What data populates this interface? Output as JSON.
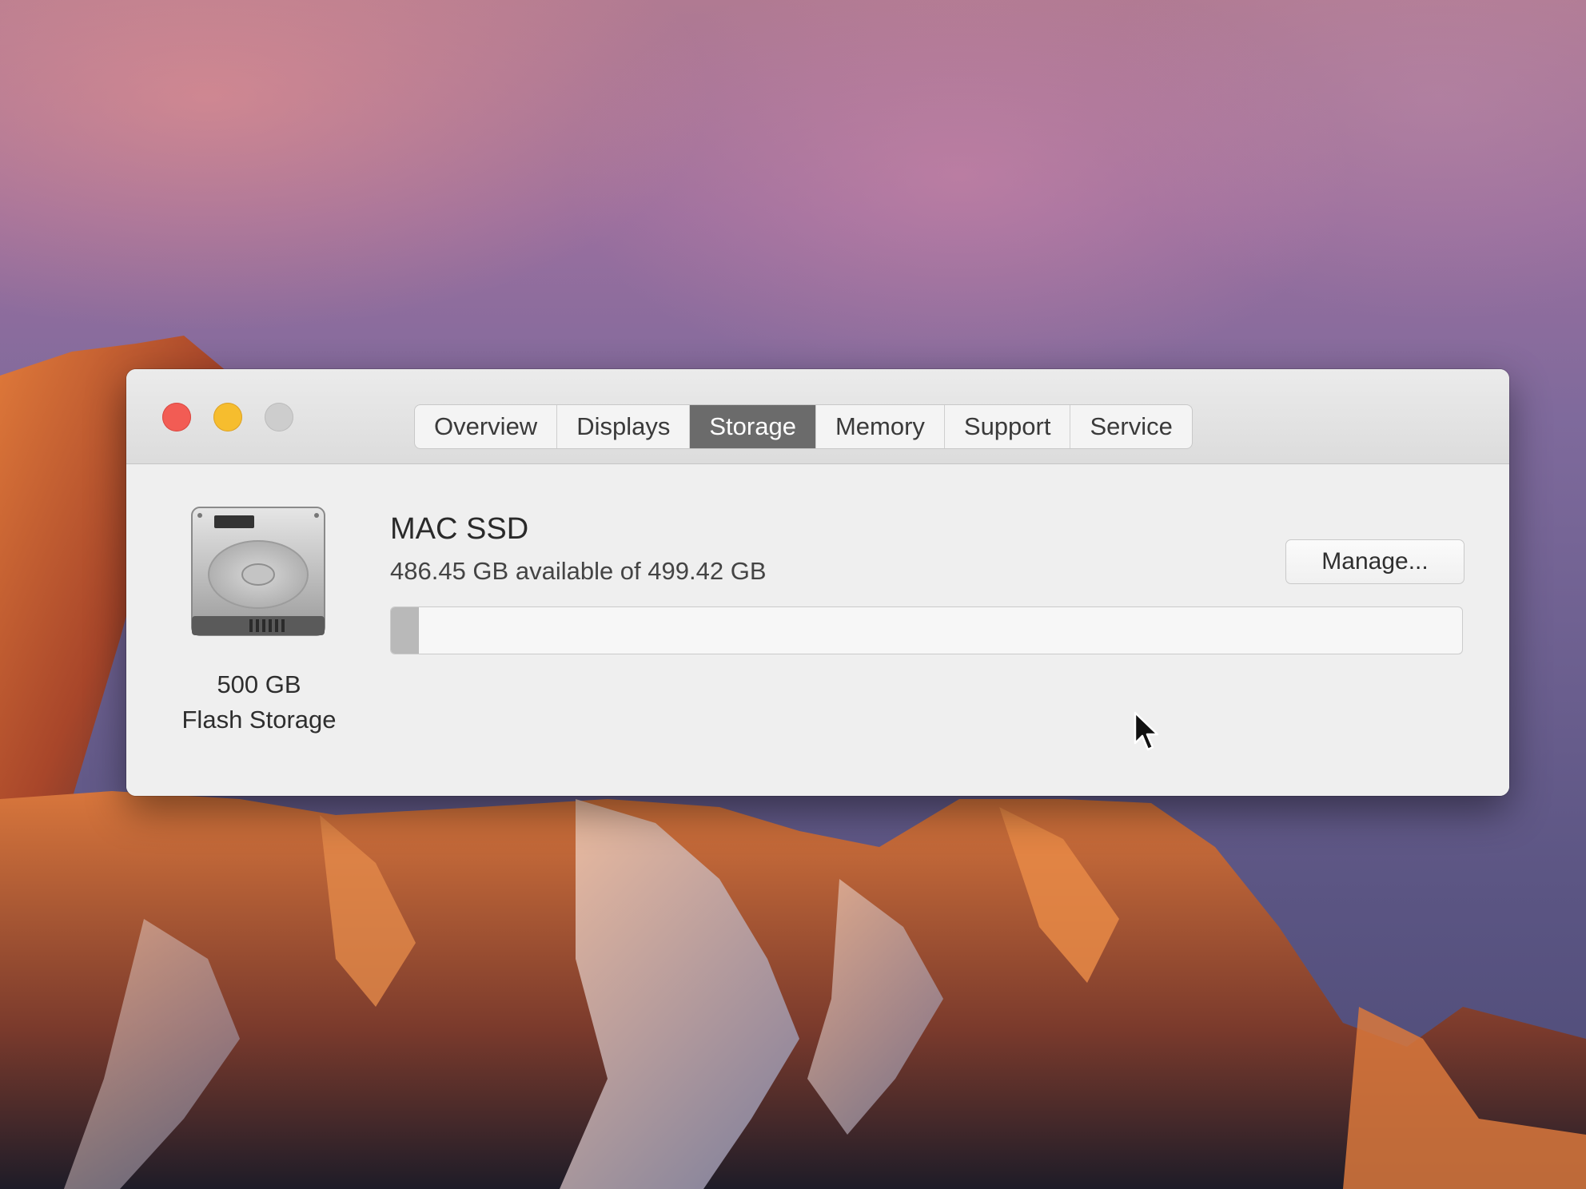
{
  "window": {
    "tabs": [
      {
        "label": "Overview",
        "active": false
      },
      {
        "label": "Displays",
        "active": false
      },
      {
        "label": "Storage",
        "active": true
      },
      {
        "label": "Memory",
        "active": false
      },
      {
        "label": "Support",
        "active": false
      },
      {
        "label": "Service",
        "active": false
      }
    ]
  },
  "storage": {
    "disk_icon": "hard-drive-icon",
    "capacity_label": "500 GB",
    "type_label": "Flash Storage",
    "volume_name": "MAC SSD",
    "availability": "486.45 GB available of 499.42 GB",
    "used_fraction": 0.026,
    "manage_label": "Manage..."
  },
  "colors": {
    "close": "#f25c54",
    "minimize": "#f6bd2e",
    "zoom": "#cdcdcd",
    "active_tab": "#6b6b6b"
  }
}
